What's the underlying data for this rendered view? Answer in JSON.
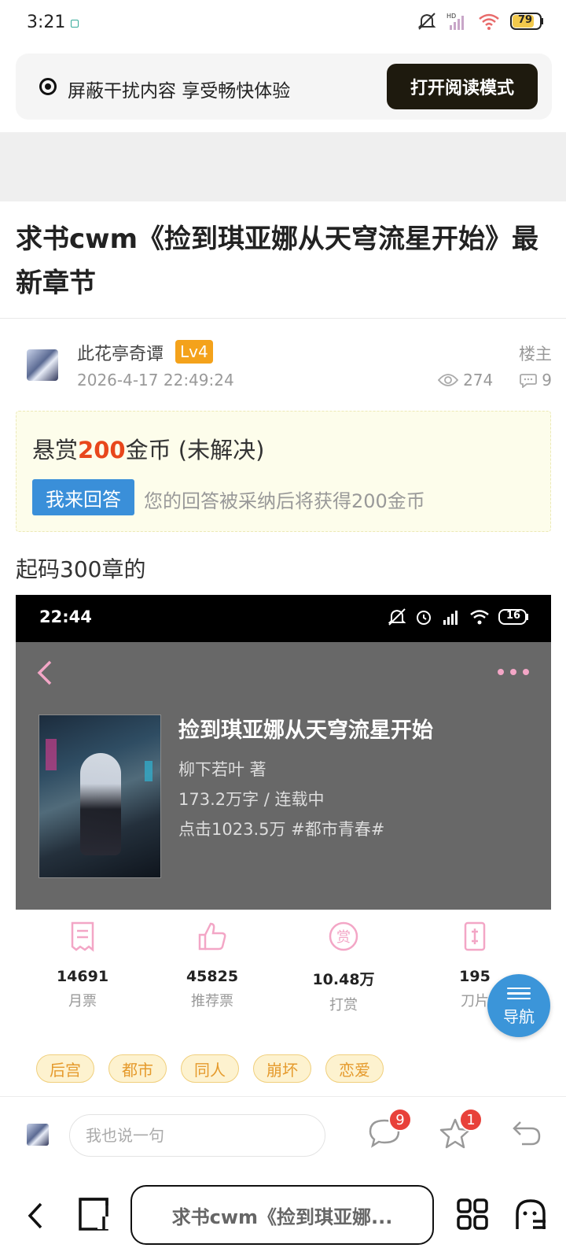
{
  "status_bar": {
    "time": "3:21",
    "battery": "79"
  },
  "banner": {
    "text": "屏蔽干扰内容 享受畅快体验",
    "button": "打开阅读模式"
  },
  "post": {
    "title": "求书cwm《捡到琪亚娜从天穹流星开始》最新章节",
    "author": "此花亭奇谭",
    "level": "Lv4",
    "date": "2026-4-17 22:49:24",
    "role": "楼主",
    "views": "274",
    "comments": "9"
  },
  "bounty": {
    "prefix": "悬赏",
    "amount": "200",
    "suffix": "金币 (未解决)",
    "answer_button": "我来回答",
    "hint": "您的回答被采纳后将获得200金币"
  },
  "body_text": "起码300章的",
  "embedded": {
    "time": "22:44",
    "battery": "16",
    "book_title": "捡到琪亚娜从天穹流星开始",
    "author": "柳下若叶  著",
    "words": "173.2万字 / 连载中",
    "clicks": "点击1023.5万  #都市青春#",
    "metrics": [
      {
        "value": "14691",
        "label": "月票",
        "icon": "ticket-icon"
      },
      {
        "value": "45825",
        "label": "推荐票",
        "icon": "thumbs-up-icon"
      },
      {
        "value": "10.48万",
        "label": "打赏",
        "icon": "reward-icon"
      },
      {
        "value": "195",
        "label": "刀片",
        "icon": "blade-icon"
      }
    ]
  },
  "tags": [
    "后宫",
    "都市",
    "同人",
    "崩坏",
    "恋爱"
  ],
  "nav_fab": {
    "label": "导航"
  },
  "comment_bar": {
    "placeholder": "我也说一句",
    "comment_badge": "9",
    "star_badge": "1"
  },
  "browser_bar": {
    "url_text": "求书cwm《捡到琪亚娜..."
  },
  "colors": {
    "accent_blue": "#3b95d9",
    "bounty_red": "#e8471c",
    "badge_red": "#e8413a",
    "tag_orange": "#e59a2c"
  }
}
